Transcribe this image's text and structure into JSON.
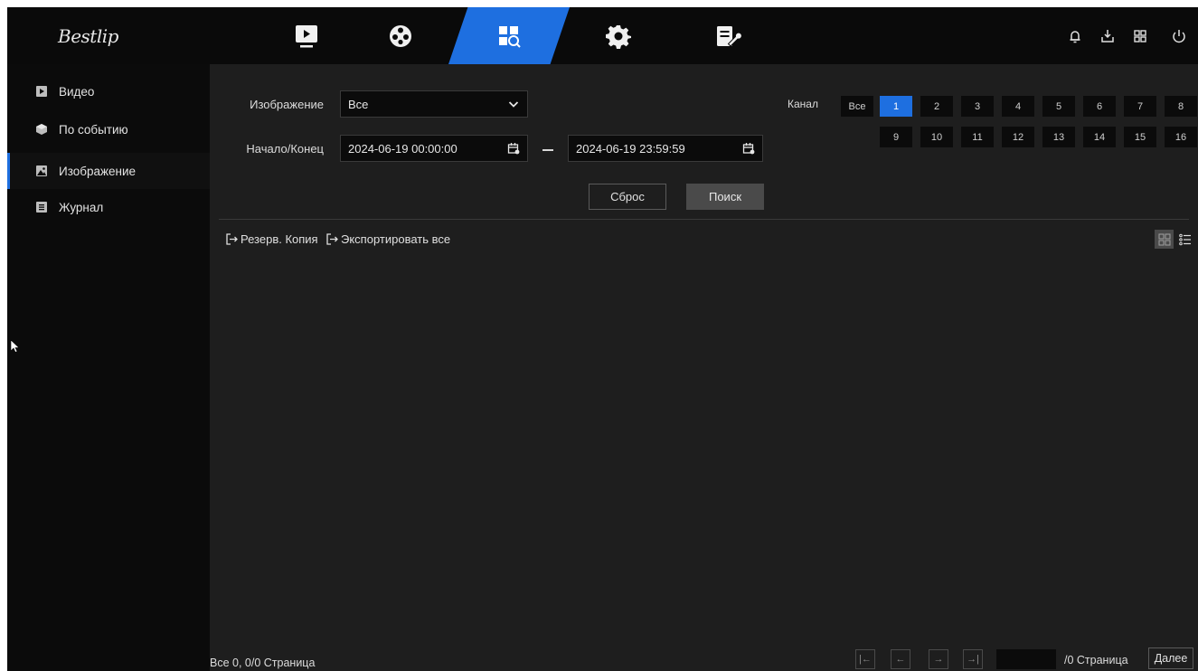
{
  "app": {
    "logo_text": "Bestlip",
    "accent_color": "#1e6fe0"
  },
  "top_nav": {
    "tabs": [
      {
        "name": "playback",
        "icon": "play-screen-icon",
        "active": false
      },
      {
        "name": "event",
        "icon": "film-reel-icon",
        "active": false
      },
      {
        "name": "search",
        "icon": "search-grid-icon",
        "active": true
      },
      {
        "name": "settings",
        "icon": "gear-icon",
        "active": false
      },
      {
        "name": "maintenance",
        "icon": "document-wrench-icon",
        "active": false
      }
    ],
    "right_icons": [
      "bell-icon",
      "download-icon",
      "grid-icon",
      "power-icon"
    ]
  },
  "sidebar": {
    "items": [
      {
        "label": "Видео",
        "icon": "play-icon",
        "active": false
      },
      {
        "label": "По событию",
        "icon": "event-cube-icon",
        "active": false
      },
      {
        "label": "Изображение",
        "icon": "image-icon",
        "active": true
      },
      {
        "label": "Журнал",
        "icon": "log-icon",
        "active": false
      }
    ]
  },
  "filters": {
    "image_label": "Изображение",
    "image_value": "Все",
    "range_label": "Начало/Конец",
    "start_value": "2024-06-19 00:00:00",
    "end_value": "2024-06-19 23:59:59",
    "reset_label": "Сброс",
    "search_label": "Поиск"
  },
  "channels": {
    "label": "Канал",
    "all_label": "Все",
    "items": [
      "1",
      "2",
      "3",
      "4",
      "5",
      "6",
      "7",
      "8",
      "9",
      "10",
      "11",
      "12",
      "13",
      "14",
      "15",
      "16"
    ],
    "selected": "1"
  },
  "actions": {
    "backup_label": "Резерв. Копия",
    "export_all_label": "Экспортировать все"
  },
  "footer": {
    "status": "Все 0, 0/0 Страница",
    "page_input": "",
    "page_total": "/0 Страница",
    "next_label": "Далее"
  }
}
